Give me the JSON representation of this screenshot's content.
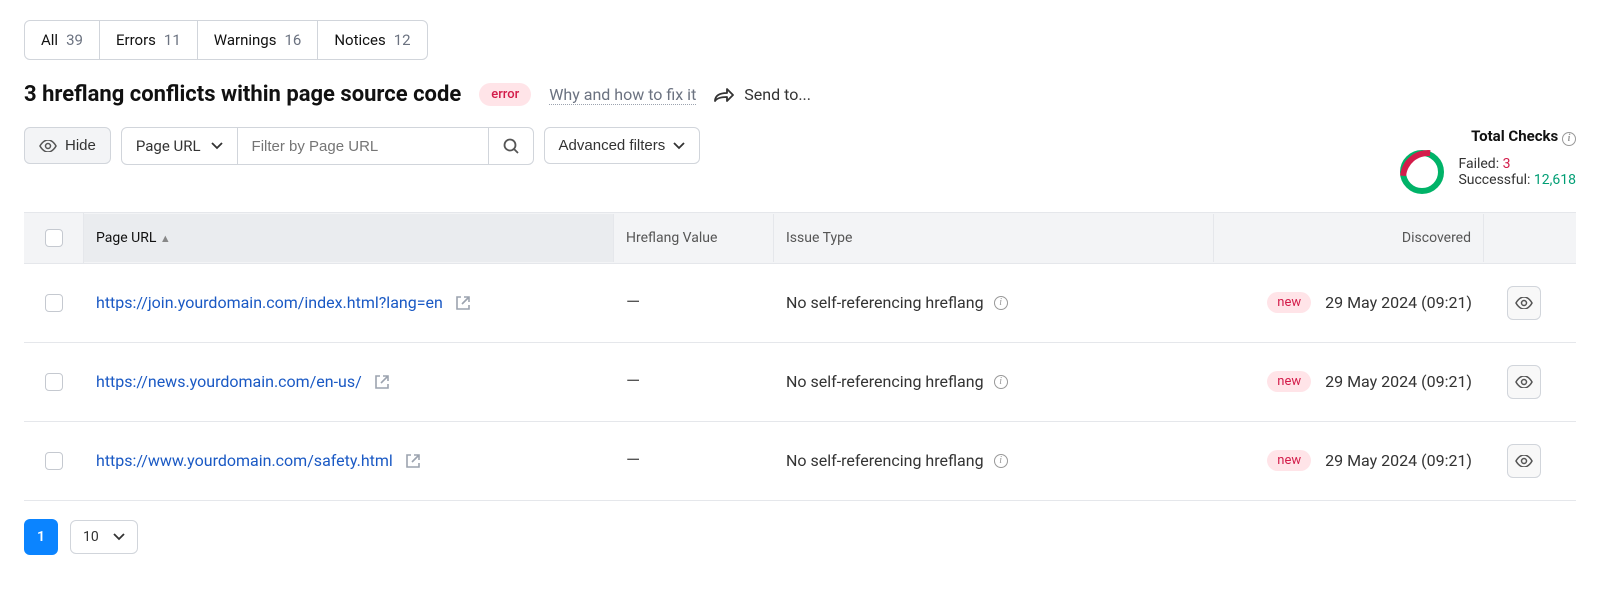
{
  "tabs": [
    {
      "label": "All",
      "count": "39"
    },
    {
      "label": "Errors",
      "count": "11"
    },
    {
      "label": "Warnings",
      "count": "16"
    },
    {
      "label": "Notices",
      "count": "12"
    }
  ],
  "title": "3 hreflang conflicts within page source code",
  "error_badge": "error",
  "fix_link": "Why and how to fix it",
  "send_to": "Send to...",
  "hide_btn": "Hide",
  "filter_field": "Page URL",
  "filter_placeholder": "Filter by Page URL",
  "advanced_filters": "Advanced filters",
  "totals": {
    "header": "Total Checks",
    "failed_label": "Failed:",
    "failed_value": "3",
    "success_label": "Successful:",
    "success_value": "12,618"
  },
  "columns": {
    "page_url": "Page URL",
    "hreflang": "Hreflang Value",
    "issue": "Issue Type",
    "discovered": "Discovered"
  },
  "rows": [
    {
      "url": "https://join.yourdomain.com/index.html?lang=en",
      "hreflang": "—",
      "issue": "No self-referencing hreflang",
      "badge": "new",
      "discovered": "29 May 2024 (09:21)"
    },
    {
      "url": "https://news.yourdomain.com/en-us/",
      "hreflang": "—",
      "issue": "No self-referencing hreflang",
      "badge": "new",
      "discovered": "29 May 2024 (09:21)"
    },
    {
      "url": "https://www.yourdomain.com/safety.html",
      "hreflang": "—",
      "issue": "No self-referencing hreflang",
      "badge": "new",
      "discovered": "29 May 2024 (09:21)"
    }
  ],
  "pagination": {
    "current": "1",
    "size": "10"
  }
}
